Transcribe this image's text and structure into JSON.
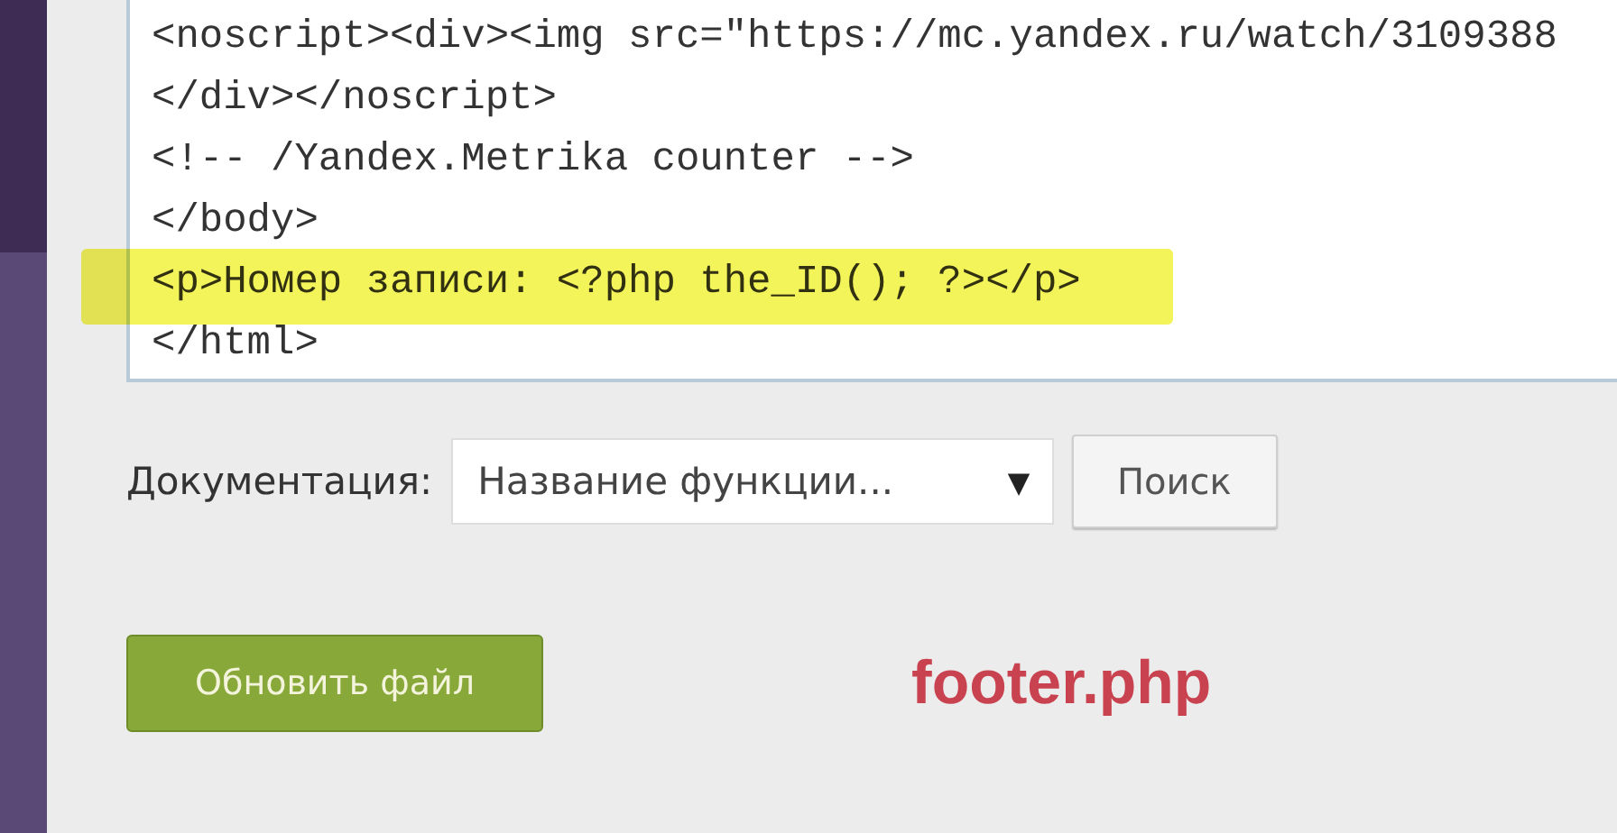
{
  "editor": {
    "lines": [
      {
        "text": "<noscript><div><img src=\"https://mc.yandex.ru/watch/3109388",
        "highlighted": false
      },
      {
        "text": "</div></noscript>",
        "highlighted": false
      },
      {
        "text": "<!-- /Yandex.Metrika counter -->",
        "highlighted": false
      },
      {
        "text": "</body>",
        "highlighted": false
      },
      {
        "text": "<p>Номер записи: <?php the_ID(); ?></p>",
        "highlighted": true
      },
      {
        "text": "</html>",
        "highlighted": false
      }
    ]
  },
  "documentation": {
    "label": "Документация:",
    "select": {
      "value": "Название функции...",
      "arrow": "▼"
    },
    "button": "Поиск"
  },
  "update_button": "Обновить файл",
  "annotation": "footer.php"
}
